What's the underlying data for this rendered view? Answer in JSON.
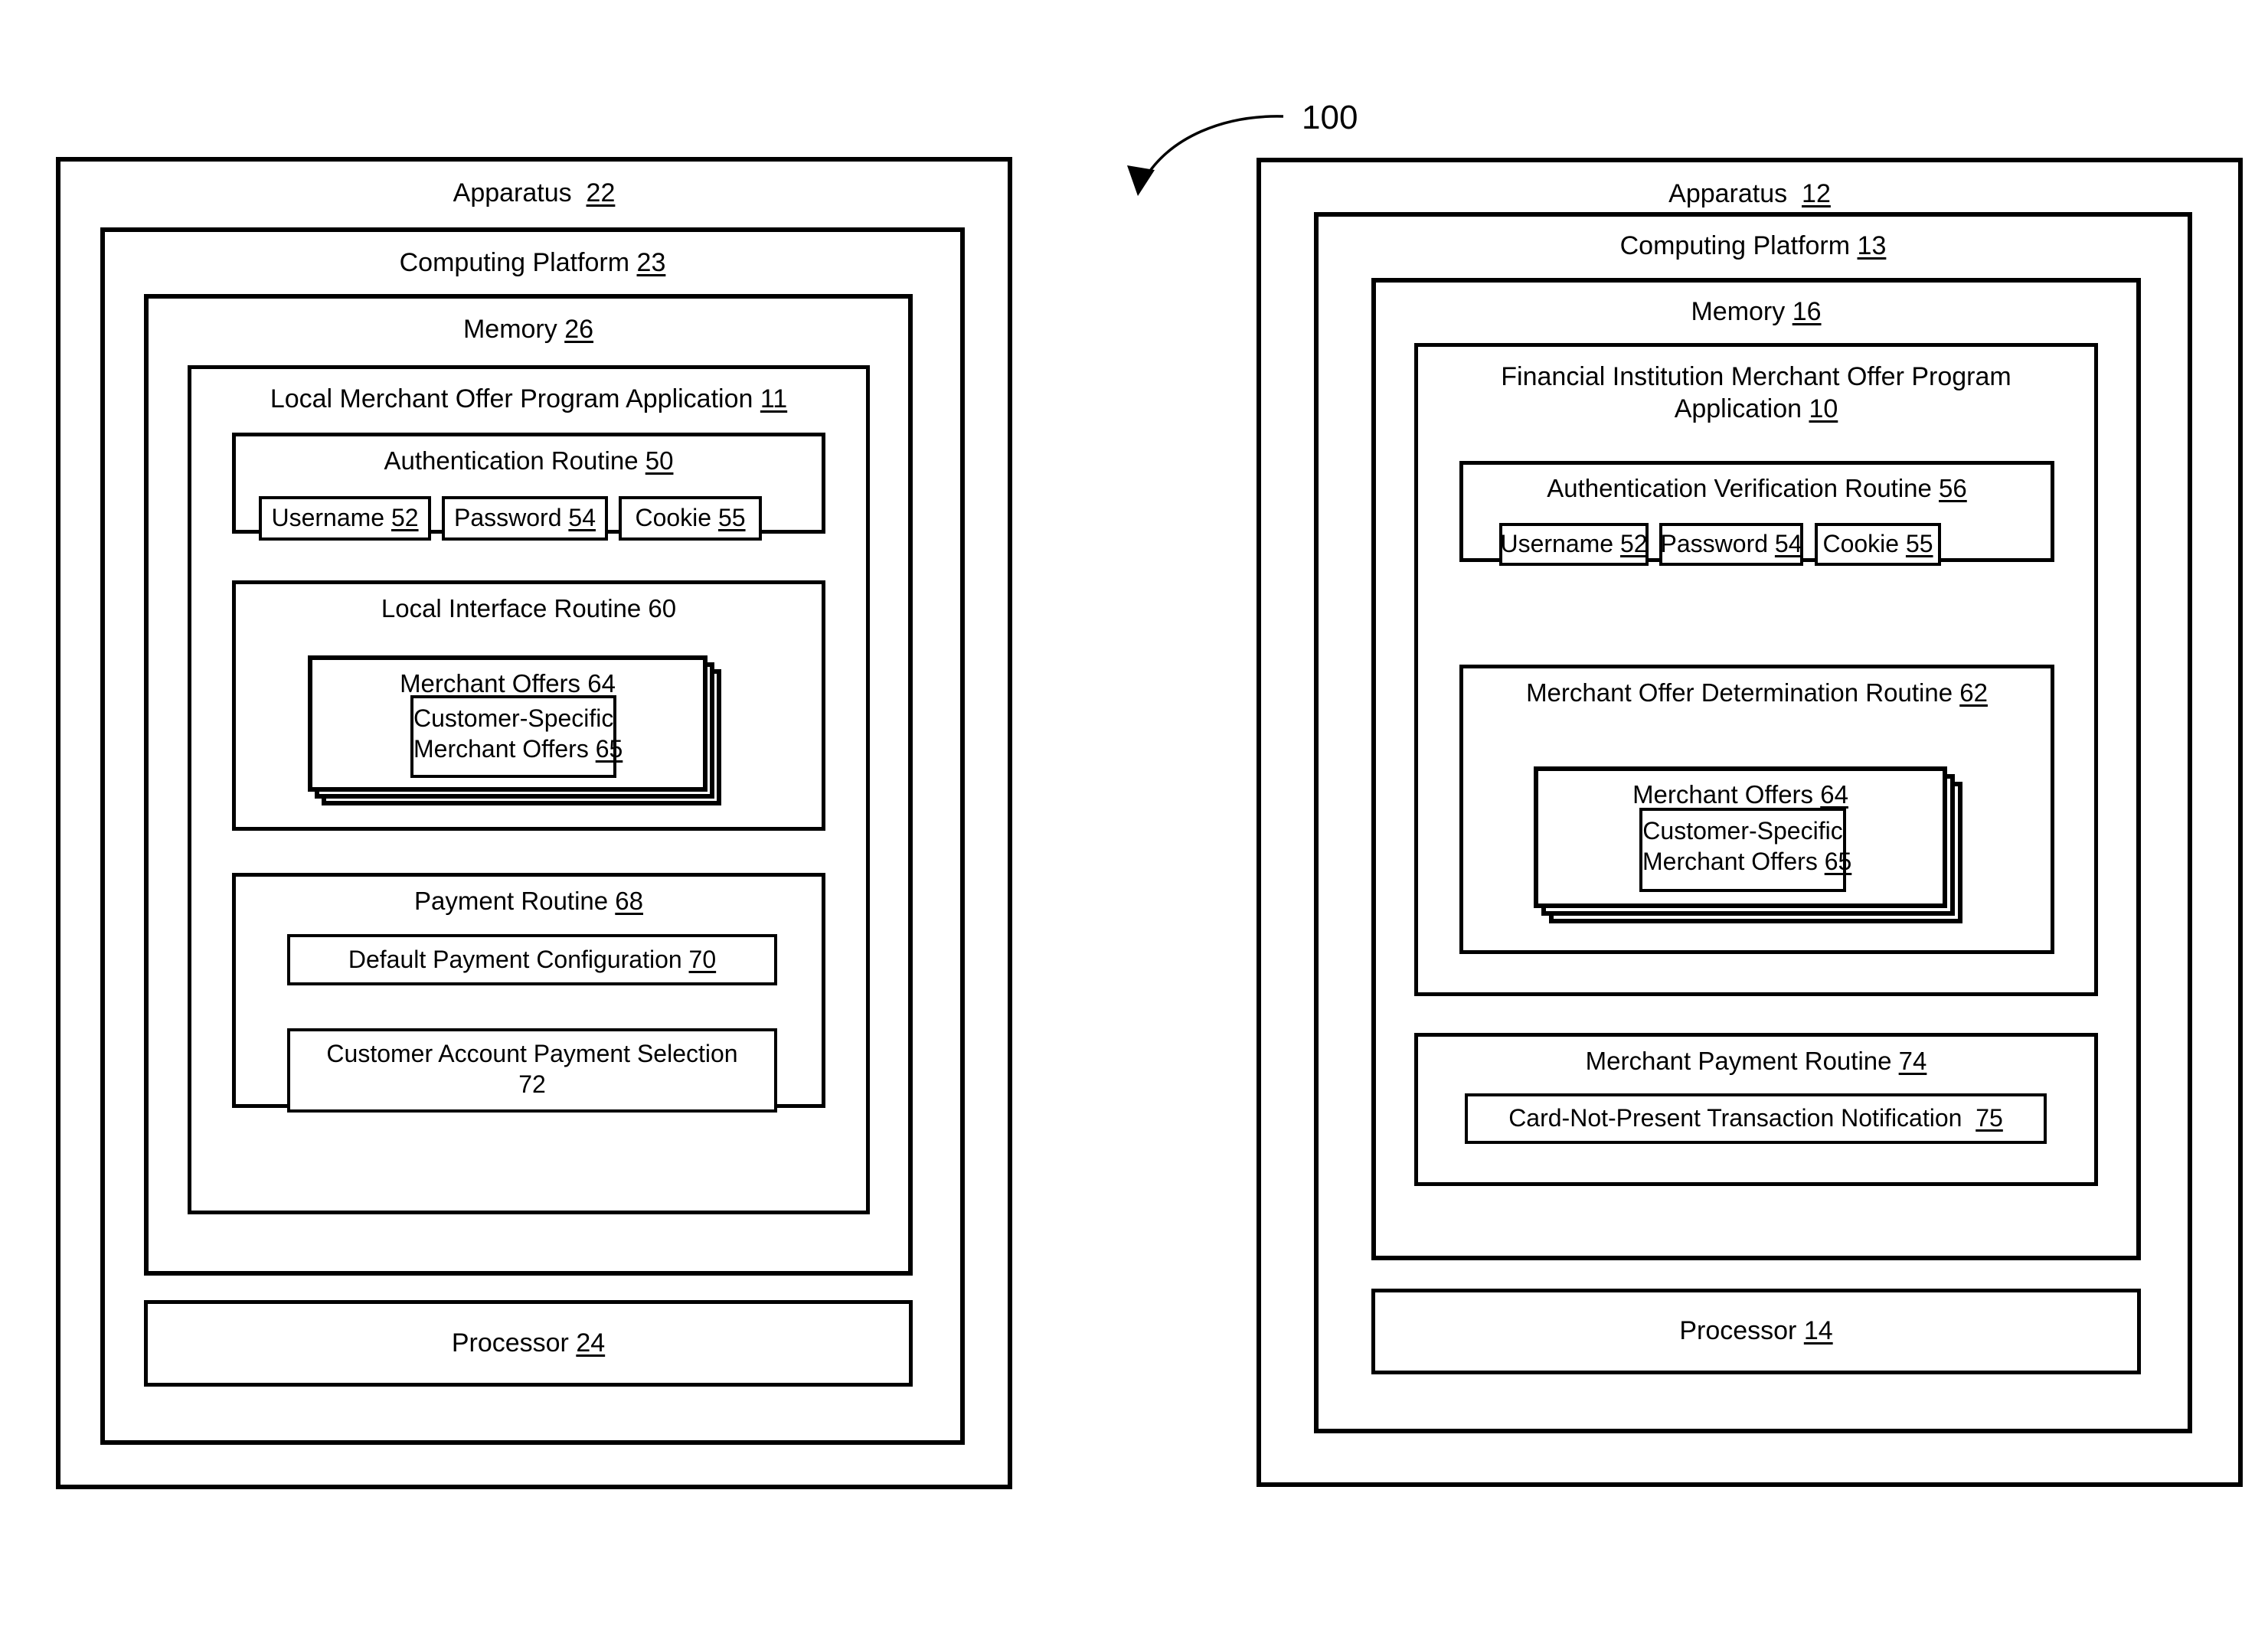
{
  "figure": {
    "reference_numeral": "100"
  },
  "left_diagram": {
    "apparatus": {
      "label": "Apparatus  22"
    },
    "computing_platform": {
      "label": "Computing Platform 23"
    },
    "memory": {
      "label": "Memory 26"
    },
    "application": {
      "label": "Local Merchant Offer Program Application 11"
    },
    "authentication_routine": {
      "label": "Authentication Routine 50",
      "fields": [
        {
          "label": "Username 52"
        },
        {
          "label": "Password 54"
        },
        {
          "label": "Cookie 55"
        }
      ]
    },
    "local_interface_routine": {
      "label": "Local Interface Routine 60",
      "merchant_offers": {
        "label": "Merchant Offers 64"
      },
      "customer_specific_offers": {
        "line1": "Customer-Specific",
        "line2": "Merchant Offers 65"
      }
    },
    "payment_routine": {
      "label": "Payment Routine 68",
      "default_payment_configuration": {
        "label": "Default Payment Configuration 70"
      },
      "customer_account_payment_selection": {
        "line1": "Customer Account Payment Selection",
        "line2": "72"
      }
    },
    "processor": {
      "label": "Processor 24"
    }
  },
  "right_diagram": {
    "apparatus": {
      "label": "Apparatus  12"
    },
    "computing_platform": {
      "label": "Computing Platform 13"
    },
    "memory": {
      "label": "Memory 16"
    },
    "application": {
      "line1": "Financial Institution Merchant Offer Program",
      "line2": "Application 10"
    },
    "authentication_verification_routine": {
      "label": "Authentication Verification Routine 56",
      "fields": [
        {
          "label": "Username 52"
        },
        {
          "label": "Password 54"
        },
        {
          "label": "Cookie 55"
        }
      ]
    },
    "merchant_offer_determination_routine": {
      "label": "Merchant Offer Determination Routine 62",
      "merchant_offers": {
        "label": "Merchant Offers 64"
      },
      "customer_specific_offers": {
        "line1": "Customer-Specific",
        "line2": "Merchant Offers 65"
      }
    },
    "merchant_payment_routine": {
      "label": "Merchant Payment Routine 74",
      "card_not_present_notification": {
        "label": "Card-Not-Present Transaction Notification  75"
      }
    },
    "processor": {
      "label": "Processor 14"
    }
  },
  "colors": {
    "stroke": "#000000",
    "background": "#ffffff"
  }
}
